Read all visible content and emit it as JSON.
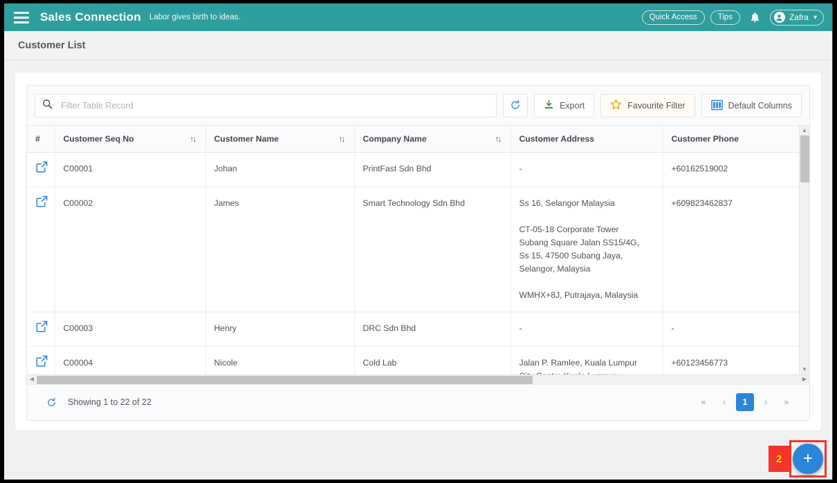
{
  "navbar": {
    "menu_icon": "hamburger-icon",
    "brand": "Sales Connection",
    "tagline": "Labor gives birth to ideas.",
    "quick_access_label": "Quick Access",
    "tips_label": "Tips",
    "bell_icon": "bell-icon",
    "user_name": "Zafra",
    "user_caret": "⌄",
    "background_color": "#2f9e9e"
  },
  "page": {
    "title": "Customer List"
  },
  "toolbar": {
    "search_placeholder": "Filter Table Record",
    "search_value": "",
    "search_icon": "search-icon",
    "refresh_label": "",
    "refresh_icon": "refresh-icon",
    "export_label": "Export",
    "export_icon": "download-icon",
    "favourite_filter_label": "Favourite Filter",
    "favourite_filter_icon": "star-icon",
    "default_columns_label": "Default Columns",
    "default_columns_icon": "columns-icon"
  },
  "table": {
    "columns": [
      {
        "label": "#",
        "sortable": false
      },
      {
        "label": "Customer Seq No",
        "sortable": true
      },
      {
        "label": "Customer Name",
        "sortable": true
      },
      {
        "label": "Company Name",
        "sortable": true
      },
      {
        "label": "Customer Address",
        "sortable": false
      },
      {
        "label": "Customer Phone",
        "sortable": false
      }
    ],
    "sort_icon": "↑↓",
    "open_icon": "open-external-icon",
    "rows": [
      {
        "seq": "C00001",
        "name": "Johan",
        "company": "PrintFast Sdn Bhd",
        "address": "-",
        "phone": "+60162519002"
      },
      {
        "seq": "C00002",
        "name": "James",
        "company": "Smart Technology Sdn Bhd",
        "address": "Ss 16, Selangor Malaysia\n\nCT-05-18 Corporate Tower\nSubang Square Jalan SS15/4G,\nSs 15, 47500 Subang Jaya,\nSelangor, Malaysia\n\nWMHX+8J, Putrajaya, Malaysia",
        "phone": "+609823462837"
      },
      {
        "seq": "C00003",
        "name": "Henry",
        "company": "DRC Sdn Bhd",
        "address": "-",
        "phone": "-"
      },
      {
        "seq": "C00004",
        "name": "Nicole",
        "company": "Cold Lab",
        "address": "Jalan P. Ramlee, Kuala Lumpur\nCity Centre Kuala Lumpur",
        "phone": "+60123456773"
      }
    ]
  },
  "footer": {
    "refresh_icon": "refresh-icon",
    "showing_text": "Showing 1 to 22 of 22",
    "pagination": {
      "first_label": "«",
      "prev_label": "‹",
      "pages": [
        "1"
      ],
      "active_page": "1",
      "next_label": "›",
      "last_label": "»"
    }
  },
  "fab": {
    "annotation_number": "2",
    "plus_label": "+",
    "color": "#2a86d8",
    "annotation_color": "#f5342a"
  }
}
